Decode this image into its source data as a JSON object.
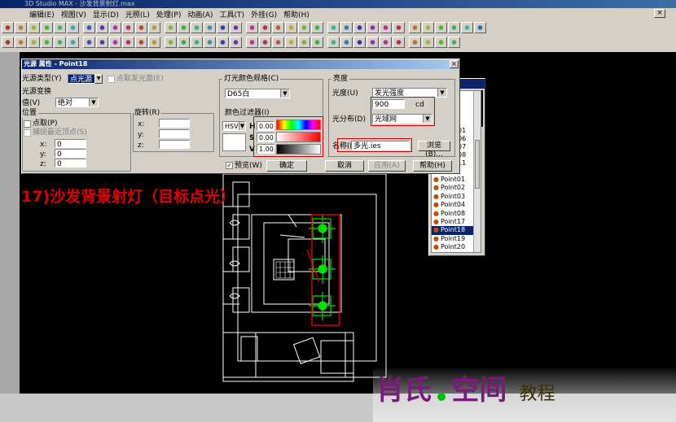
{
  "app": {
    "title": "3D Studio MAX - 沙发背景射灯.max"
  },
  "menu": [
    "编辑(E)",
    "视图(V)",
    "显示(D)",
    "光照(L)",
    "处理(P)",
    "动画(A)",
    "工具(T)",
    "外挂(G)",
    "帮助(H)"
  ],
  "window_controls": {
    "close": "×"
  },
  "dialog": {
    "title": "光源 属性 - Point18",
    "close": "×",
    "light_type": {
      "label": "光源类型(Y)",
      "value": "点光源",
      "shadow_label": "点取发光面(E)"
    },
    "transform": {
      "title": "光源变换",
      "value_label": "值(V)",
      "value": "绝对",
      "position_title": "位置",
      "pick_point_label": "点取(P)",
      "snap_label": "捕捉最近顶点(S)",
      "x_label": "x:",
      "y_label": "y:",
      "z_label": "z:",
      "x": "0",
      "y": "0",
      "z": "0",
      "rotate_title": "旋转(R)",
      "rx": "",
      "ry": "",
      "rz": ""
    },
    "color": {
      "title": "灯光颜色规格(C)",
      "preset": "D65白",
      "filter_title": "颜色过滤器(I)",
      "mode": "HSV",
      "h_label": "H",
      "s_label": "S",
      "v_label": "V",
      "h": "0.00",
      "s": "0.00",
      "v": "1.00"
    },
    "brightness": {
      "title": "亮度",
      "intensity_label": "光度(U)",
      "intensity_type": "发光强度",
      "value": "900",
      "unit": "cd",
      "distribution_label": "光分布(D)",
      "distribution": "光域网",
      "file_label": "名称(N)",
      "file": "多光.ies",
      "browse": "浏览(B)..."
    },
    "preview_label": "预览(W)",
    "ok": "确定",
    "cancel": "取消",
    "apply": "应用(A)",
    "help": "帮助(H)"
  },
  "light_list": {
    "items": [
      "Point01",
      "Point02",
      "Point03",
      "Point04",
      "Point08",
      "Point17",
      "Point18",
      "Point19",
      "Point20"
    ],
    "selected": "Point18",
    "partial_labels": [
      "01",
      "06",
      "07",
      "08",
      "11"
    ]
  },
  "caption": "17)沙发背景射灯（目标点光）",
  "watermark": {
    "brand_1": "肖氏",
    "brand_2": "空间",
    "tag": "教程"
  },
  "colors": {
    "accent_red": "#e00000",
    "selection_blue": "#0a246a",
    "title_blue": "#0a246a",
    "grid_green": "#00e000"
  }
}
